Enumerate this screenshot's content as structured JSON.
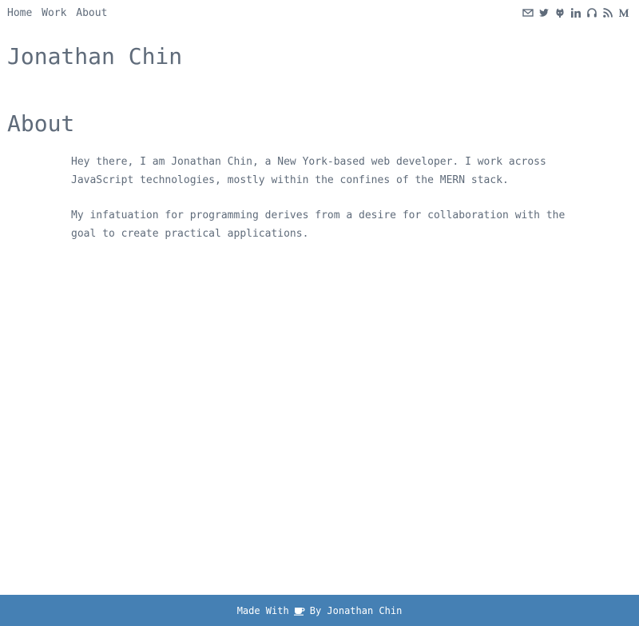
{
  "nav": {
    "items": [
      {
        "label": "Home"
      },
      {
        "label": "Work"
      },
      {
        "label": "About"
      }
    ]
  },
  "social": {
    "icons": [
      "email-icon",
      "twitter-icon",
      "github-icon",
      "linkedin-icon",
      "headphones-icon",
      "rss-icon",
      "medium-icon"
    ]
  },
  "header": {
    "title": "Jonathan Chin"
  },
  "main": {
    "title": "About",
    "paragraphs": [
      "Hey there, I am Jonathan Chin, a New York-based web developer. I work across JavaScript technologies, mostly within the confines of the MERN stack.",
      "My infatuation for programming derives from a desire for collaboration with the goal to create practical applications."
    ]
  },
  "footer": {
    "prefix": "Made With",
    "suffix": "By Jonathan Chin",
    "icon": "coffee-icon"
  },
  "colors": {
    "text": "#5f6b7a",
    "footer_bg": "#4580b4",
    "footer_text": "#ffffff"
  }
}
